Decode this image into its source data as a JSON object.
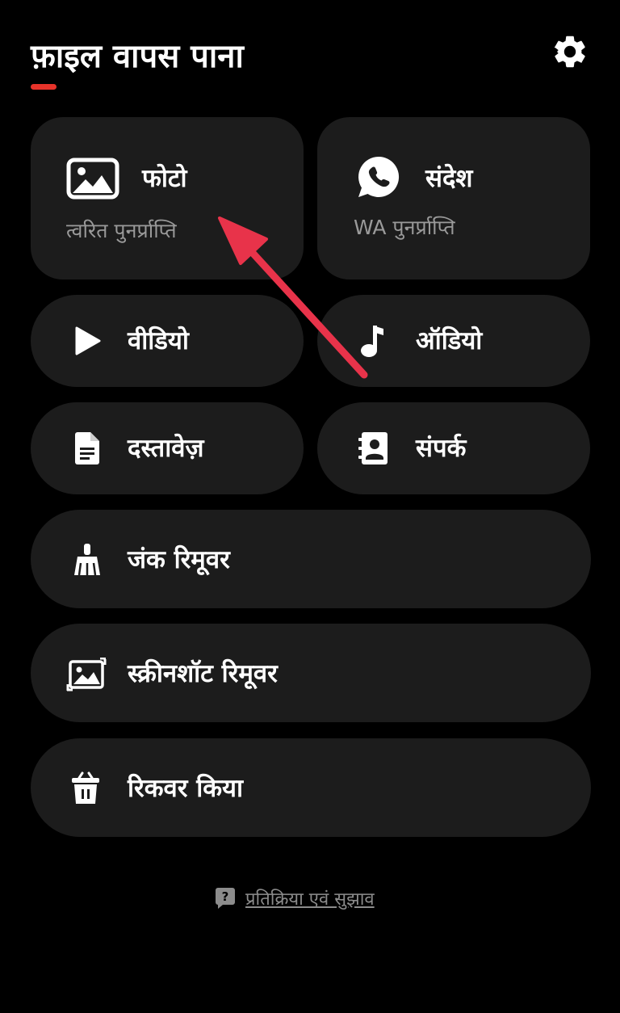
{
  "header": {
    "title": "फ़ाइल वापस पाना",
    "accent_color": "#e7332a",
    "settings_icon": "gear-icon"
  },
  "cards": {
    "photo": {
      "label": "फोटो",
      "sub": "त्वरित पुनर्प्राप्ति",
      "icon": "image-icon"
    },
    "messages": {
      "label": "संदेश",
      "sub": "WA पुनर्प्राप्ति",
      "icon": "whatsapp-icon"
    },
    "video": {
      "label": "वीडियो",
      "icon": "play-icon"
    },
    "audio": {
      "label": "ऑडियो",
      "icon": "music-note-icon"
    },
    "documents": {
      "label": "दस्तावेज़",
      "icon": "document-icon"
    },
    "contacts": {
      "label": "संपर्क",
      "icon": "contact-book-icon"
    },
    "junk": {
      "label": "जंक रिमूवर",
      "icon": "broom-icon"
    },
    "screenshot": {
      "label": "स्क्रीनशॉट रिमूवर",
      "icon": "screenshot-image-icon"
    },
    "recovered": {
      "label": "रिकवर किया",
      "icon": "trash-restore-icon"
    }
  },
  "footer": {
    "feedback": "प्रतिक्रिया एवं सुझाव",
    "feedback_icon": "help-chat-icon"
  },
  "colors": {
    "background": "#000000",
    "card": "#1c1c1c",
    "annotation_arrow": "#e8334a"
  }
}
